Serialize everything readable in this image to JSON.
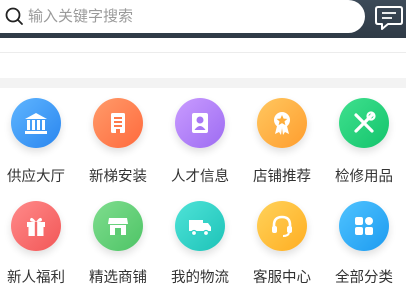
{
  "search": {
    "placeholder": "输入关键字搜索",
    "icon": "search-icon"
  },
  "header": {
    "message_icon": "message-icon"
  },
  "menu": [
    {
      "label": "供应大厅",
      "icon": "building-icon",
      "color_from": "#5fb5ff",
      "color_to": "#2a86ef"
    },
    {
      "label": "新梯安装",
      "icon": "document-icon",
      "color_from": "#ff9b6a",
      "color_to": "#ff6a3d"
    },
    {
      "label": "人才信息",
      "icon": "user-card-icon",
      "color_from": "#c99bff",
      "color_to": "#9d6cf2"
    },
    {
      "label": "店铺推荐",
      "icon": "award-badge-icon",
      "color_from": "#ffc75f",
      "color_to": "#ff9d2e"
    },
    {
      "label": "检修用品",
      "icon": "tools-icon",
      "color_from": "#3fe08e",
      "color_to": "#14c46c"
    },
    {
      "label": "新人福利",
      "icon": "gift-icon",
      "color_from": "#ff8a8a",
      "color_to": "#f25757"
    },
    {
      "label": "精选商铺",
      "icon": "storefront-icon",
      "color_from": "#7fdd8e",
      "color_to": "#4ec466"
    },
    {
      "label": "我的物流",
      "icon": "truck-icon",
      "color_from": "#4fe3d8",
      "color_to": "#1dc3b8"
    },
    {
      "label": "客服中心",
      "icon": "headset-icon",
      "color_from": "#ffd25a",
      "color_to": "#ffae22"
    },
    {
      "label": "全部分类",
      "icon": "grid-icon",
      "color_from": "#4fc3ff",
      "color_to": "#1d9bf0"
    }
  ]
}
